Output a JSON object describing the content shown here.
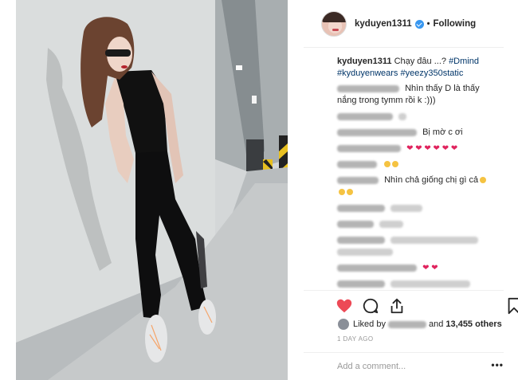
{
  "header": {
    "username": "kyduyen1311",
    "separator": "•",
    "follow_status": "Following"
  },
  "caption": {
    "username": "kyduyen1311",
    "text": "Chạy đâu ...?",
    "tags": [
      "#Dmind",
      "#kyduyenwears",
      "#yeezy350static"
    ]
  },
  "comments": [
    {
      "text": "Nhìn thấy D là thấy nắng trong tymm rồi k :)))"
    },
    {
      "text": ""
    },
    {
      "text": "Bị mờ c ơi"
    },
    {
      "text": ""
    },
    {
      "text": ""
    },
    {
      "text": "Nhìn chả giống chị gì cả"
    },
    {
      "text": ""
    },
    {
      "text": ""
    },
    {
      "text": ""
    },
    {
      "text": ""
    },
    {
      "text": ""
    },
    {
      "text": ""
    }
  ],
  "likes": {
    "prefix": "Liked by",
    "middle": "and",
    "count": "13,455 others"
  },
  "timestamp": "1 DAY AGO",
  "comment_box": {
    "placeholder": "Add a comment...",
    "more": "•••"
  },
  "colors": {
    "accent": "#3897f0",
    "like_red": "#ed4956",
    "hashtag": "#003569",
    "muted": "#999999"
  },
  "icons": [
    "heart-filled-icon",
    "comment-icon",
    "share-icon",
    "bookmark-icon",
    "more-icon",
    "verified-icon"
  ]
}
